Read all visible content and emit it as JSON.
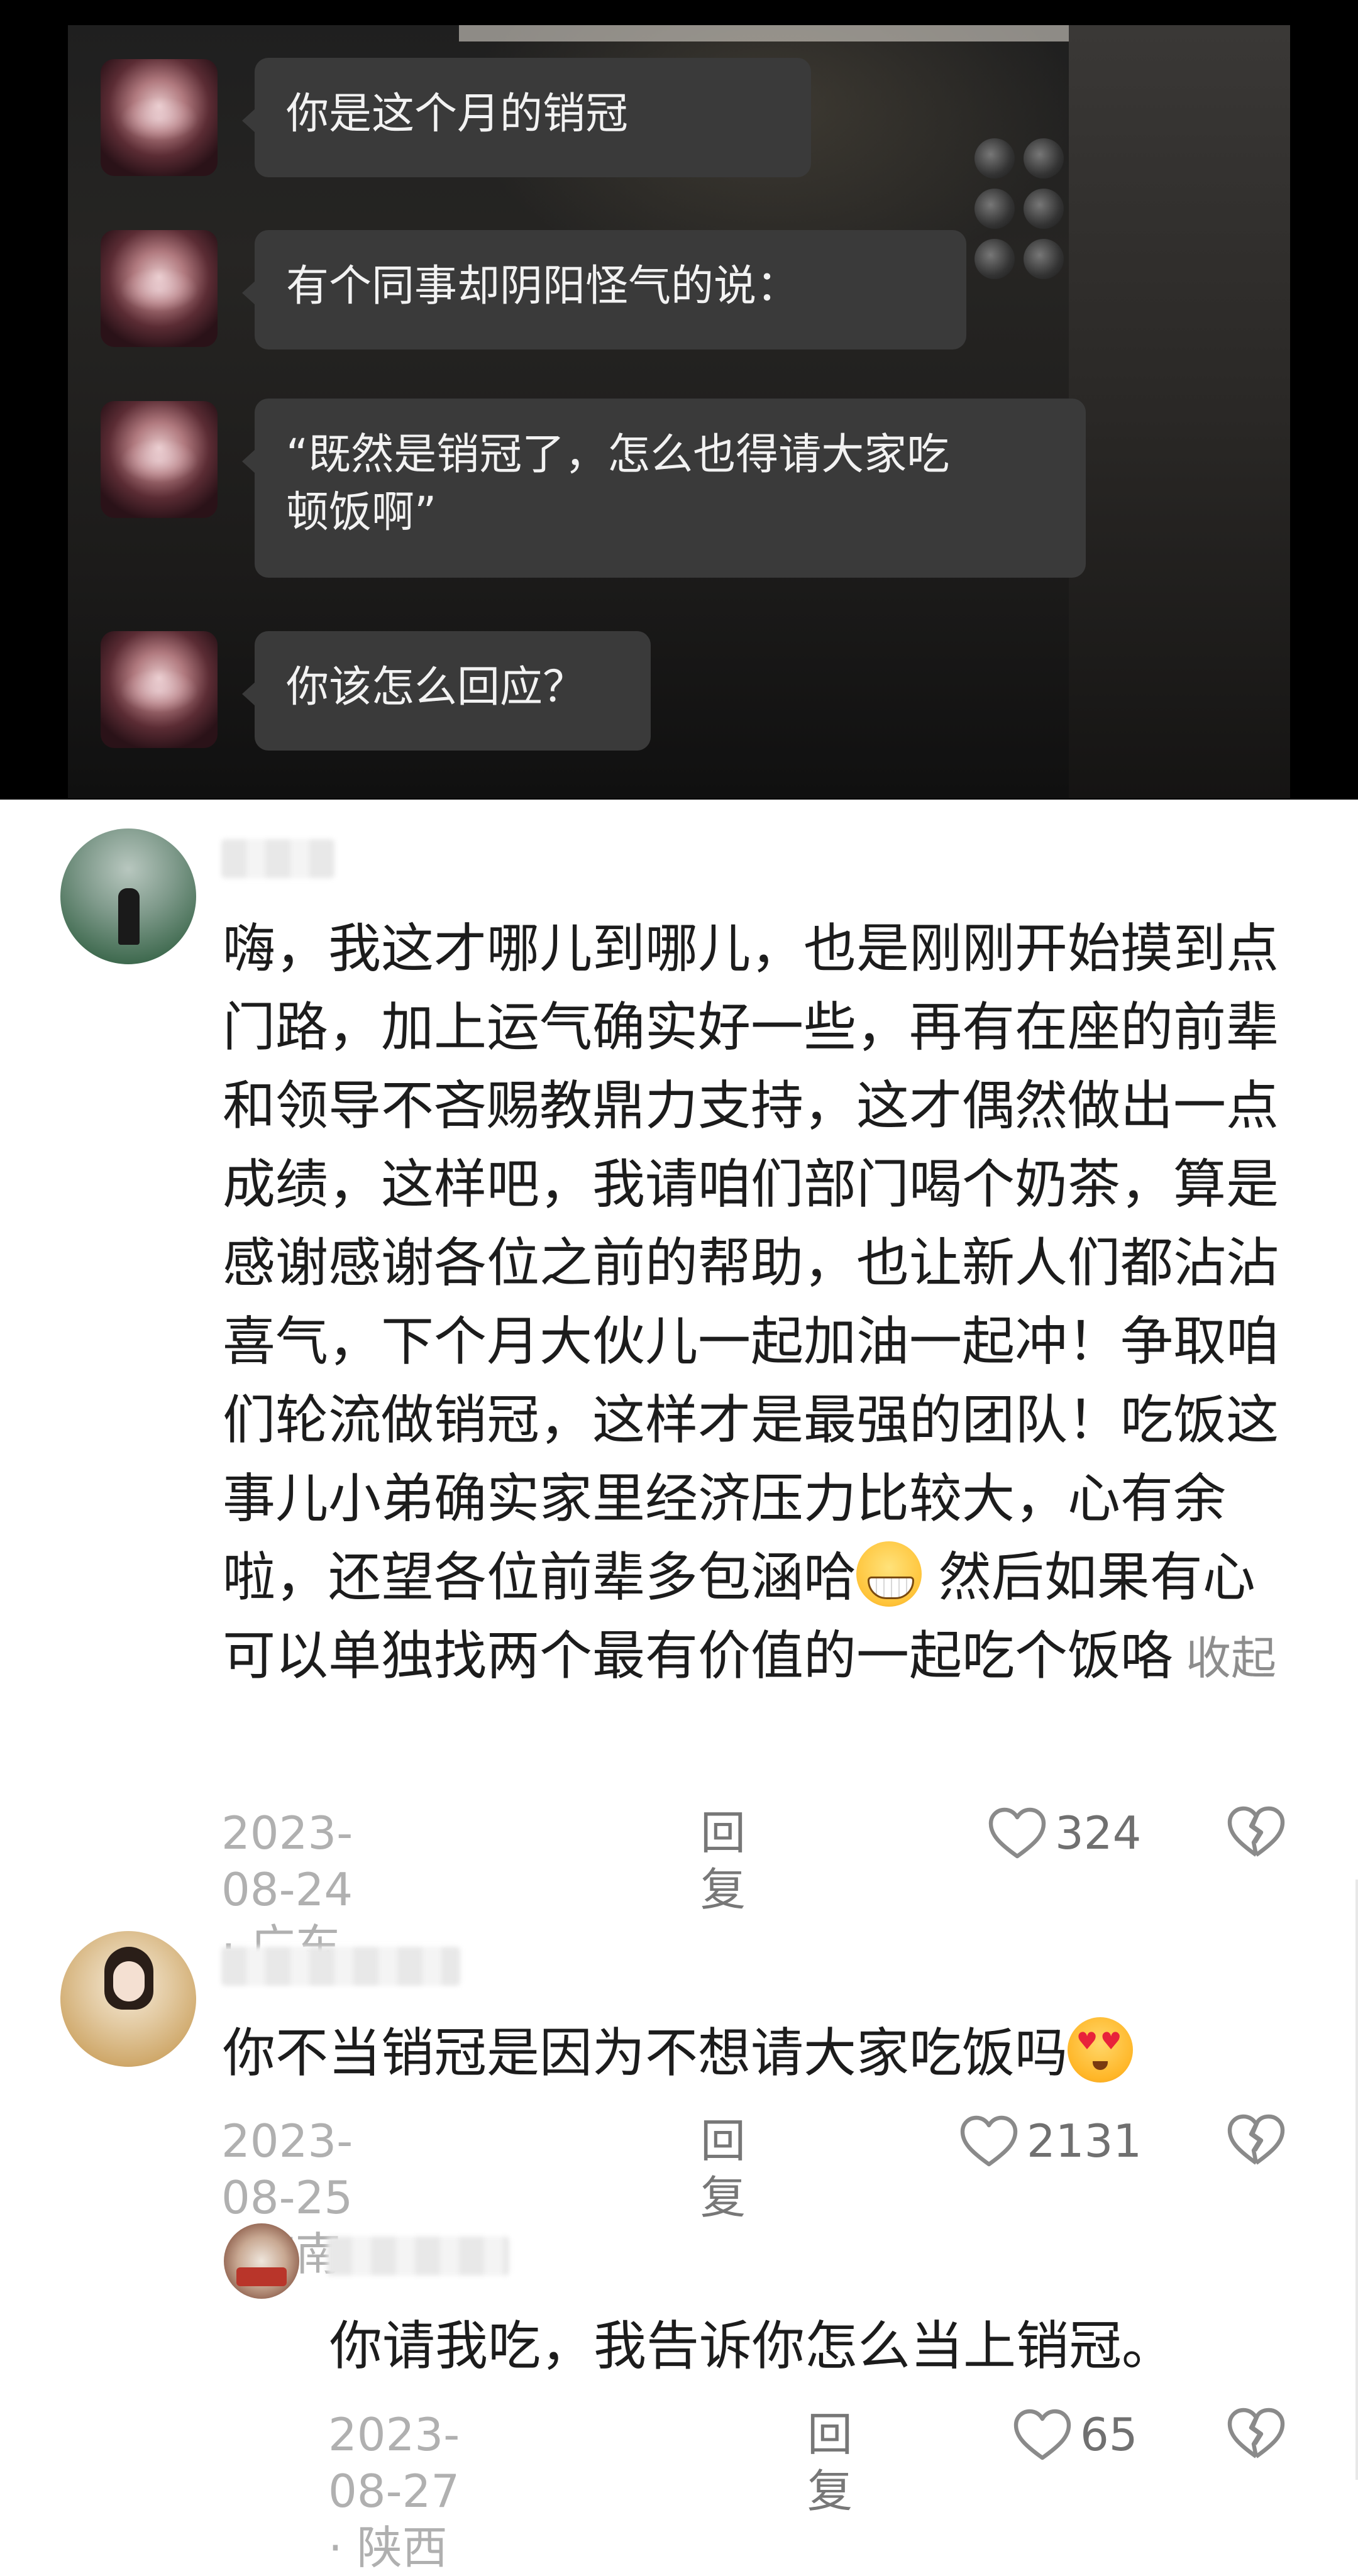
{
  "video": {
    "messages": [
      {
        "text": "你是这个月的销冠"
      },
      {
        "text": "有个同事却阴阳怪气的说："
      },
      {
        "text": "“既然是销冠了，怎么也得请大家吃\n顿饭啊”"
      },
      {
        "text": "你该怎么回应？"
      }
    ]
  },
  "comments": [
    {
      "text": "嗨，我这才哪儿到哪儿，也是刚刚开始摸到点门路，加上运气确实好一些，再有在座的前辈和领导不吝赐教鼎力支持，这才偶然做出一点成绩，这样吧，我请咱们部门喝个奶茶，算是感谢感谢各位之前的帮助，也让新人们都沾沾喜气，下个月大伙儿一起加油一起冲！争取咱们轮流做销冠，这样才是最强的团队！吃饭这事儿小弟确实家里经济压力比较大，心有余啦，还望各位前辈多包涵哈",
      "text_after_emoji": " 然后如果有心可以单独找两个最有价值的一起吃个饭咯",
      "collapse_label": "收起",
      "emoji": "grinning-face-emoji",
      "date": "2023-08-24",
      "location": "广东",
      "meta_separator": " · ",
      "reply_label": "回复",
      "likes": "324"
    },
    {
      "text": "你不当销冠是因为不想请大家吃饭吗",
      "emoji": "heart-eyes-emoji",
      "date": "2023-08-25",
      "location": "海南",
      "meta_separator": " · ",
      "reply_label": "回复",
      "likes": "2131"
    },
    {
      "text": "你请我吃，我告诉你怎么当上销冠。",
      "date": "2023-08-27",
      "location": "陕西",
      "meta_separator": " · ",
      "reply_label": "回复",
      "likes": "65"
    }
  ],
  "colors": {
    "bubble": "#3a3a3a",
    "bubble_text": "#f2f2f2",
    "comment_text": "#1c1c1c",
    "meta_text": "#b0b0b0",
    "collapse_text": "#8d8d8d"
  },
  "icons": [
    "heart-outline-icon",
    "broken-heart-icon"
  ]
}
